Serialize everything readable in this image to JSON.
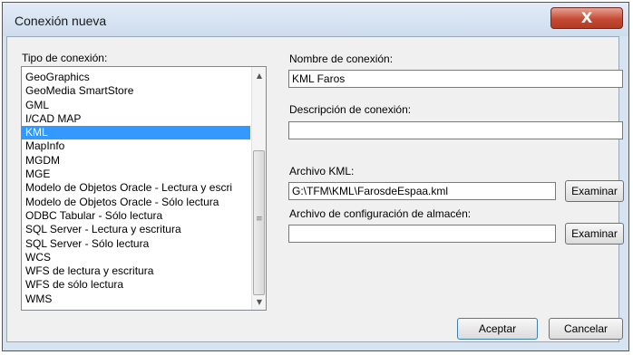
{
  "window": {
    "title": "Conexión nueva",
    "close_glyph": "X"
  },
  "connection_type": {
    "label": "Tipo de conexión:",
    "items": [
      "GeoGraphics",
      "GeoMedia SmartStore",
      "GML",
      "I/CAD MAP",
      "KML",
      "MapInfo",
      "MGDM",
      "MGE",
      "Modelo de Objetos Oracle - Lectura y escri",
      "Modelo de Objetos Oracle - Sólo lectura",
      "ODBC Tabular - Sólo lectura",
      "SQL Server - Lectura y escritura",
      "SQL Server - Sólo lectura",
      "WCS",
      "WFS de lectura y escritura",
      "WFS de sólo lectura",
      "WMS"
    ],
    "selected": "KML"
  },
  "connection_name": {
    "label": "Nombre de conexión:",
    "value": "KML Faros"
  },
  "connection_description": {
    "label": "Descripción de conexión:",
    "value": ""
  },
  "kml_file": {
    "label": "Archivo KML:",
    "value": "G:\\TFM\\KML\\FarosdeEspaa.kml",
    "browse_label": "Examinar"
  },
  "storage_config": {
    "label": "Archivo de configuración de almacén:",
    "value": "",
    "browse_label": "Examinar"
  },
  "buttons": {
    "accept": "Aceptar",
    "cancel": "Cancelar"
  }
}
